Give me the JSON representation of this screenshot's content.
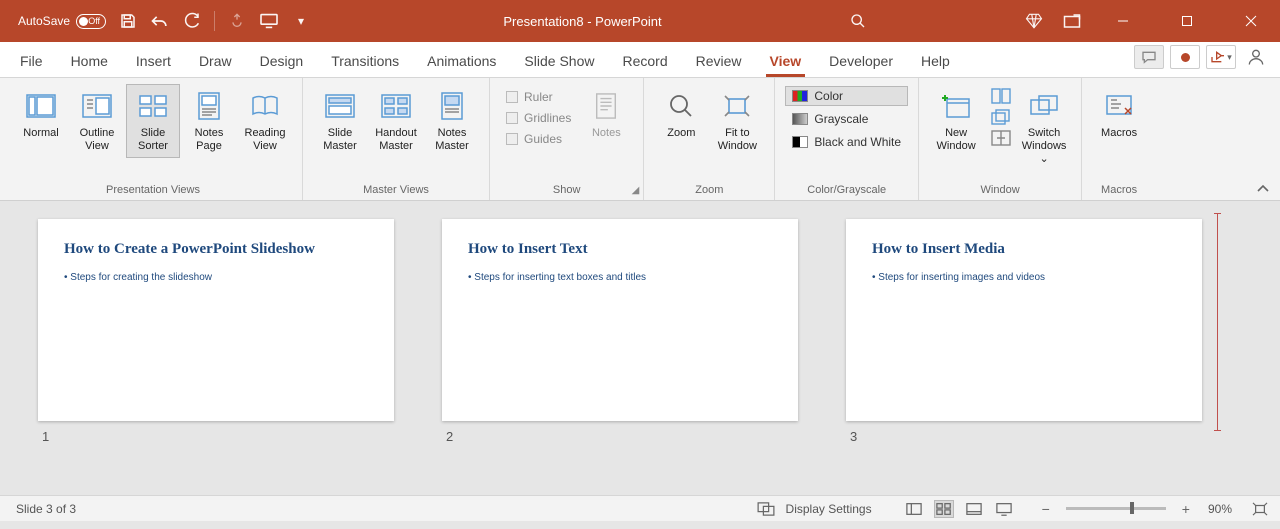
{
  "titlebar": {
    "autosave_label": "AutoSave",
    "autosave_state": "Off",
    "doc_title": "Presentation8  -  PowerPoint"
  },
  "tabs": {
    "file": "File",
    "home": "Home",
    "insert": "Insert",
    "draw": "Draw",
    "design": "Design",
    "transitions": "Transitions",
    "animations": "Animations",
    "slideshow": "Slide Show",
    "record": "Record",
    "review": "Review",
    "view": "View",
    "developer": "Developer",
    "help": "Help"
  },
  "ribbon": {
    "presentation_views": {
      "label": "Presentation Views",
      "normal": "Normal",
      "outline": "Outline\nView",
      "sorter": "Slide\nSorter",
      "notes_page": "Notes\nPage",
      "reading": "Reading\nView"
    },
    "master_views": {
      "label": "Master Views",
      "slide_master": "Slide\nMaster",
      "handout_master": "Handout\nMaster",
      "notes_master": "Notes\nMaster"
    },
    "show": {
      "label": "Show",
      "ruler": "Ruler",
      "gridlines": "Gridlines",
      "guides": "Guides"
    },
    "notes_btn": "Notes",
    "zoom": {
      "label": "Zoom",
      "zoom_btn": "Zoom",
      "fit": "Fit to\nWindow"
    },
    "color_grayscale": {
      "label": "Color/Grayscale",
      "color": "Color",
      "grayscale": "Grayscale",
      "bw": "Black and White"
    },
    "window": {
      "label": "Window",
      "new_window": "New\nWindow",
      "switch": "Switch\nWindows"
    },
    "macros": {
      "label": "Macros",
      "btn": "Macros"
    }
  },
  "slides": [
    {
      "title": "How to Create a PowerPoint Slideshow",
      "bullet": "Steps for creating the slideshow",
      "num": "1"
    },
    {
      "title": "How to Insert Text",
      "bullet": "Steps for inserting text boxes and titles",
      "num": "2"
    },
    {
      "title": "How to Insert Media",
      "bullet": "Steps for inserting images and videos",
      "num": "3"
    }
  ],
  "statusbar": {
    "slide_info": "Slide 3 of 3",
    "display_settings": "Display Settings",
    "zoom_pct": "90%"
  }
}
